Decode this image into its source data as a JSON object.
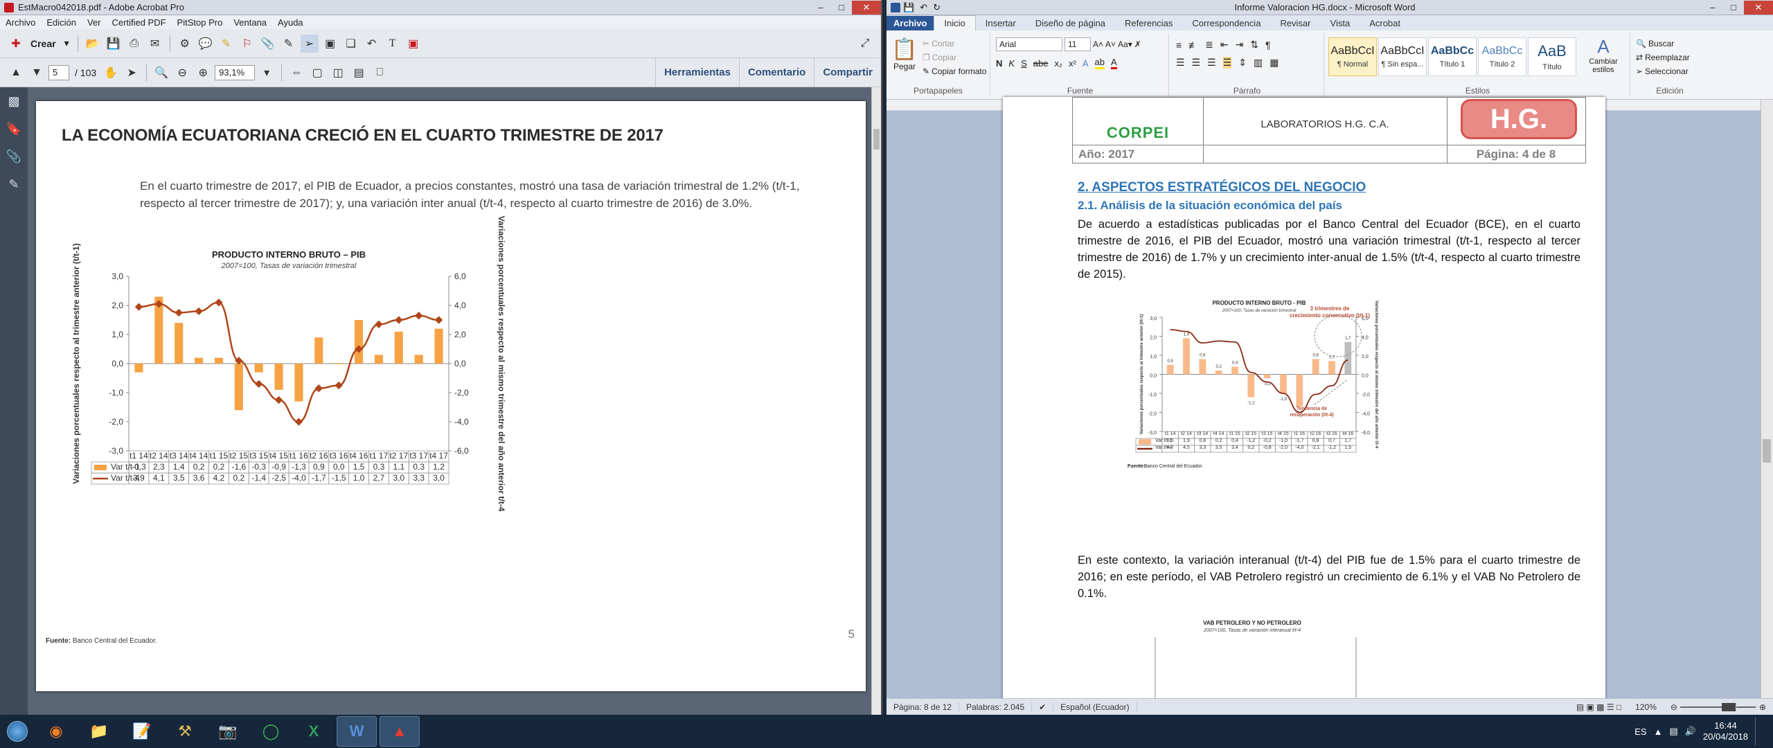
{
  "acrobat": {
    "title": "EstMacro042018.pdf - Adobe Acrobat Pro",
    "menu": [
      "Archivo",
      "Edición",
      "Ver",
      "Certified PDF",
      "PitStop Pro",
      "Ventana",
      "Ayuda"
    ],
    "toolbar": {
      "create": "Crear",
      "page_current": "5",
      "page_total": "/ 103",
      "zoom": "93,1%",
      "links": [
        "Herramientas",
        "Comentario",
        "Compartir"
      ]
    },
    "doc": {
      "title": "LA ECONOMÍA ECUATORIANA CRECIÓ EN EL CUARTO TRIMESTRE DE 2017",
      "paragraph": "En el cuarto trimestre de 2017, el PIB de Ecuador, a precios constantes, mostró una tasa de variación trimestral de 1.2% (t/t-1, respecto al tercer trimestre de 2017); y, una variación inter anual (t/t-4, respecto al  cuarto trimestre de 2016) de 3.0%.",
      "source_label": "Fuente:",
      "source_text": "Banco Central del Ecuador.",
      "page_number": "5"
    }
  },
  "word": {
    "title": "Informe Valoracion HG.docx - Microsoft Word",
    "tabs": [
      "Archivo",
      "Inicio",
      "Insertar",
      "Diseño de página",
      "Referencias",
      "Correspondencia",
      "Revisar",
      "Vista",
      "Acrobat"
    ],
    "ribbon": {
      "paste": "Pegar",
      "cut": "Cortar",
      "copy": "Copiar",
      "format_painter": "Copiar formato",
      "clipboard": "Portapapeles",
      "font": "Arial",
      "size": "11",
      "font_group": "Fuente",
      "paragraph_group": "Párrafo",
      "styles_group": "Estilos",
      "editing_group": "Edición",
      "styles": [
        {
          "sample": "AaBbCcI",
          "name": "¶ Normal"
        },
        {
          "sample": "AaBbCcI",
          "name": "¶ Sin espa..."
        },
        {
          "sample": "AaBbCc",
          "name": "Título 1"
        },
        {
          "sample": "AaBbCc",
          "name": "Título 2"
        },
        {
          "sample": "AaB",
          "name": "Título"
        }
      ],
      "change_styles": "Cambiar estilos",
      "search": "Buscar",
      "replace": "Reemplazar",
      "select": "Seleccionar"
    },
    "doc": {
      "header_left_logo": "CORPEI",
      "header_company": "LABORATORIOS H.G. C.A.",
      "header_year": "Año: 2017",
      "header_page": "Página: 4 de 8",
      "header_logo": "H.G.",
      "h2": "2. ASPECTOS ESTRATÉGICOS DEL NEGOCIO",
      "h3": "2.1. Análisis de la situación económica del país",
      "p1": "De acuerdo a estadísticas publicadas por el Banco Central del Ecuador (BCE), en el cuarto trimestre de 2016, el PIB del Ecuador, mostró una variación trimestral (t/t-1, respecto al tercer trimestre de 2016) de 1.7% y un crecimiento inter-anual de 1.5% (t/t-4, respecto al cuarto trimestre de 2015).",
      "fig_source_label": "Fuente:",
      "fig_source": "Banco Central del Ecuador.",
      "p2": "En este contexto, la variación interanual (t/t-4) del PIB fue de 1.5% para el cuarto trimestre de 2016; en este período, el VAB Petrolero registró un crecimiento de 6.1% y el VAB No Petrolero de 0.1%."
    },
    "status": {
      "page": "Página: 8 de 12",
      "words": "Palabras: 2.045",
      "lang": "Español (Ecuador)",
      "zoom": "120%"
    }
  },
  "taskbar": {
    "lang": "ES",
    "time": "16:44",
    "date": "20/04/2018"
  },
  "chart_data": [
    {
      "type": "bar",
      "title": "PRODUCTO INTERNO BRUTO – PIB",
      "subtitle": "2007=100, Tasas de variación trimestral",
      "ylabel": "Variaciones porcentuales respecto al trimestre anterior (t/t-1)",
      "ylabel_right": "Variaciones porcentuales respecto al mismo trimestre del año anterior t/t-4",
      "ylim": [
        -3,
        3
      ],
      "ylim_right": [
        -6,
        6
      ],
      "yticks": [
        "3,0",
        "2,0",
        "1,0",
        "0,0",
        "-1,0",
        "-2,0",
        "-3,0"
      ],
      "yticks_right": [
        "6,0",
        "4,0",
        "2,0",
        "0,0",
        "-2,0",
        "-4,0",
        "-6,0"
      ],
      "categories": [
        "t1 14",
        "t2 14",
        "t3 14",
        "t4 14",
        "t1 15",
        "t2 15",
        "t3 15",
        "t4 15",
        "t1 16",
        "t2 16",
        "t3 16",
        "t4 16",
        "t1 17",
        "t2 17",
        "t3 17",
        "t4 17"
      ],
      "series": [
        {
          "name": "Var t/t-1",
          "type": "bar",
          "axis": "left",
          "color": "#f7a245",
          "values": [
            -0.3,
            2.3,
            1.4,
            0.2,
            0.2,
            -1.6,
            -0.3,
            -0.9,
            -1.3,
            0.9,
            0.0,
            1.5,
            0.3,
            1.1,
            0.3,
            1.2
          ]
        },
        {
          "name": "Var t/t-4",
          "type": "line",
          "axis": "right",
          "color": "#b0461a",
          "values": [
            3.9,
            4.1,
            3.5,
            3.6,
            4.2,
            0.2,
            -1.4,
            -2.5,
            -4.0,
            -1.7,
            -1.5,
            1.0,
            2.7,
            3.0,
            3.3,
            3.0
          ]
        }
      ],
      "table_values": {
        "Var t/t-1": [
          "-0,3",
          "2,3",
          "1,4",
          "0,2",
          "0,2",
          "-1,6",
          "-0,3",
          "-0,9",
          "-1,3",
          "0,9",
          "0,0",
          "1,5",
          "0,3",
          "1,1",
          "0,3",
          "1,2"
        ],
        "Var t/t-4": [
          "3,9",
          "4,1",
          "3,5",
          "3,6",
          "4,2",
          "0,2",
          "-1,4",
          "-2,5",
          "-4,0",
          "-1,7",
          "-1,5",
          "1,0",
          "2,7",
          "3,0",
          "3,3",
          "3,0"
        ]
      }
    },
    {
      "type": "bar",
      "title": "PRODUCTO INTERNO BRUTO - PIB",
      "subtitle": "2007=100, Tasas de variación trimestral",
      "ylabel": "Variaciones porcentuales respecto al trimestre anterior (t/t-1)",
      "ylabel_right": "Variaciones porcentuales respecto al mismo trimestre del año anterior t/t-4",
      "annotation_top": "3 trimestres de crecimiento consecutivo (t/t-1)",
      "annotation_bottom": "Tendencia de recuperación (t/t-4)",
      "ylim": [
        -3,
        3
      ],
      "ylim_right": [
        -6,
        6
      ],
      "yticks": [
        "3,0",
        "2,0",
        "1,0",
        "0,0",
        "-1,0",
        "-2,0",
        "-3,0"
      ],
      "yticks_right": [
        "6,0",
        "4,0",
        "2,0",
        "0,0",
        "-2,0",
        "-4,0",
        "-6,0"
      ],
      "categories": [
        "t1 14",
        "t2 14",
        "t3 14",
        "t4 14",
        "t1 15",
        "t2 15",
        "t3 15",
        "t4 15",
        "t1 16",
        "t2 16",
        "t3 16",
        "t4 16"
      ],
      "series": [
        {
          "name": "Var t/t-1",
          "type": "bar",
          "axis": "left",
          "color": "#f9b98a",
          "values": [
            0.5,
            1.9,
            0.8,
            0.2,
            0.4,
            -1.2,
            -0.2,
            -1.0,
            -1.7,
            0.8,
            0.7,
            1.7
          ]
        },
        {
          "name": "Var t/t-4",
          "type": "line",
          "axis": "right",
          "color": "#8b2a14",
          "values": [
            4.7,
            4.5,
            3.3,
            3.5,
            3.4,
            0.2,
            -0.8,
            -2.0,
            -4.0,
            -2.1,
            -1.2,
            1.5
          ]
        }
      ],
      "table_values": {
        "Var t/t-1": [
          "0,5",
          "1,9",
          "0,8",
          "0,2",
          "0,4",
          "-1,2",
          "-0,2",
          "-1,0",
          "-1,7",
          "0,8",
          "0,7",
          "1,7"
        ],
        "Var t/t-4": [
          "4,7",
          "4,5",
          "3,3",
          "3,5",
          "3,4",
          "0,2",
          "-0,8",
          "-2,0",
          "-4,0",
          "-2,1",
          "-1,2",
          "1,5"
        ]
      }
    },
    {
      "type": "bar",
      "title": "VAB PETROLERO Y NO PETROLERO",
      "subtitle": "2007=100, Tasas de variación interanual t/t-4"
    }
  ]
}
